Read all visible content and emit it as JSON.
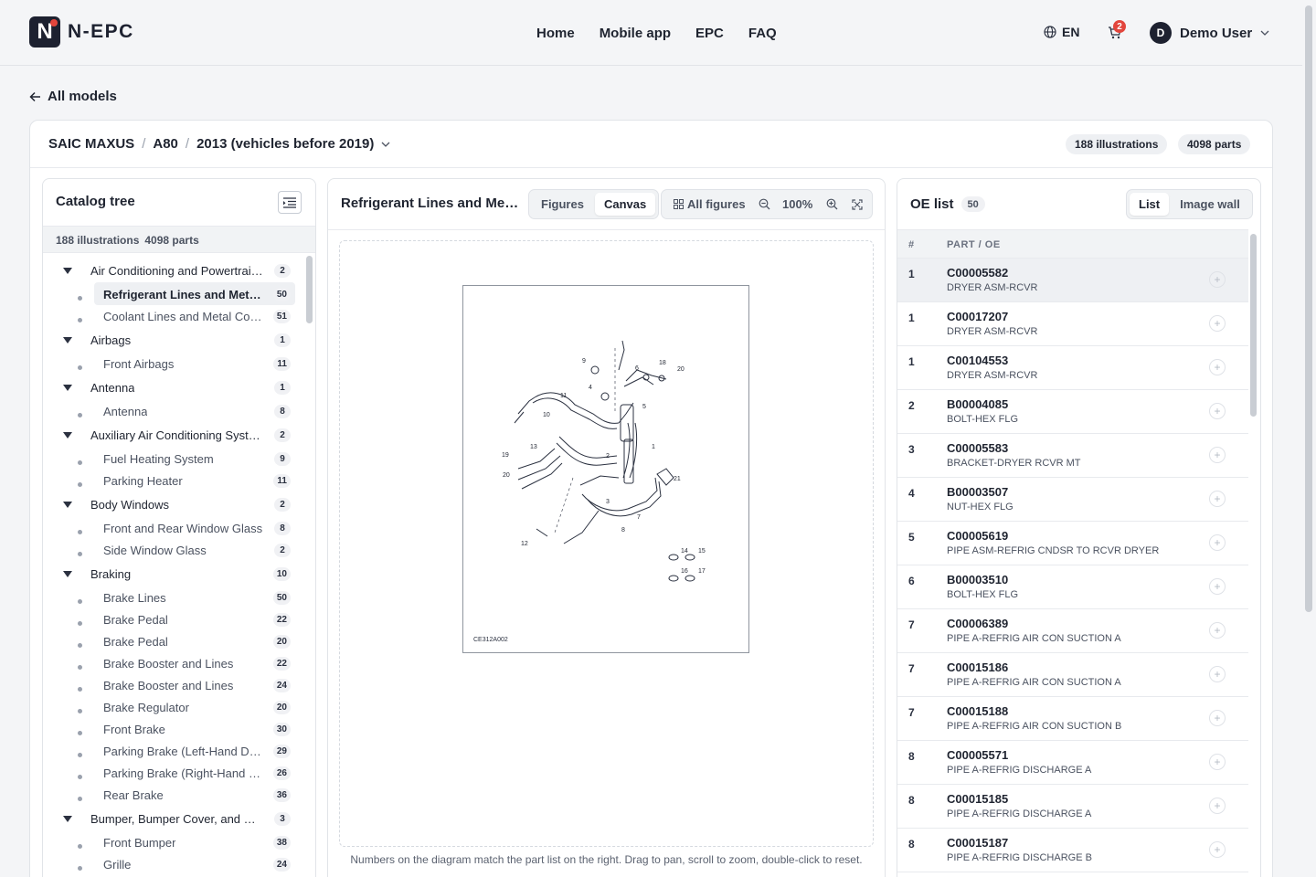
{
  "brand": {
    "name": "N-EPC",
    "logo_letter": "N"
  },
  "nav": {
    "items": [
      "Home",
      "Mobile app",
      "EPC",
      "FAQ"
    ]
  },
  "header": {
    "language": "EN",
    "cart_count": "2",
    "user_initial": "D",
    "user_name": "Demo User"
  },
  "back": {
    "label": "All models"
  },
  "breadcrumb": {
    "brand": "SAIC MAXUS",
    "model": "A80",
    "year": "2013 (vehicles before 2019)"
  },
  "stats": {
    "illustrations": "188 illustrations",
    "parts": "4098 parts"
  },
  "tree": {
    "title": "Catalog tree",
    "stats_illustrations": "188 illustrations",
    "stats_parts": "4098 parts",
    "items": [
      {
        "type": "cat",
        "label": "Air Conditioning and Powertrain Cooling",
        "count": "2"
      },
      {
        "type": "sub",
        "label": "Refrigerant Lines and Metal Components",
        "count": "50",
        "active": true
      },
      {
        "type": "sub",
        "label": "Coolant Lines and Metal Components",
        "count": "51"
      },
      {
        "type": "cat",
        "label": "Airbags",
        "count": "1"
      },
      {
        "type": "sub",
        "label": "Front Airbags",
        "count": "11"
      },
      {
        "type": "cat",
        "label": "Antenna",
        "count": "1"
      },
      {
        "type": "sub",
        "label": "Antenna",
        "count": "8"
      },
      {
        "type": "cat",
        "label": "Auxiliary Air Conditioning System",
        "count": "2"
      },
      {
        "type": "sub",
        "label": "Fuel Heating System",
        "count": "9"
      },
      {
        "type": "sub",
        "label": "Parking Heater",
        "count": "11"
      },
      {
        "type": "cat",
        "label": "Body Windows",
        "count": "2"
      },
      {
        "type": "sub",
        "label": "Front and Rear Window Glass",
        "count": "8"
      },
      {
        "type": "sub",
        "label": "Side Window Glass",
        "count": "2"
      },
      {
        "type": "cat",
        "label": "Braking",
        "count": "10"
      },
      {
        "type": "sub",
        "label": "Brake Lines",
        "count": "50"
      },
      {
        "type": "sub",
        "label": "Brake Pedal",
        "count": "22"
      },
      {
        "type": "sub",
        "label": "Brake Pedal",
        "count": "20"
      },
      {
        "type": "sub",
        "label": "Brake Booster and Lines",
        "count": "22"
      },
      {
        "type": "sub",
        "label": "Brake Booster and Lines",
        "count": "24"
      },
      {
        "type": "sub",
        "label": "Brake Regulator",
        "count": "20"
      },
      {
        "type": "sub",
        "label": "Front Brake",
        "count": "30"
      },
      {
        "type": "sub",
        "label": "Parking Brake (Left-Hand Drive)",
        "count": "29"
      },
      {
        "type": "sub",
        "label": "Parking Brake (Right-Hand Drive)",
        "count": "26"
      },
      {
        "type": "sub",
        "label": "Rear Brake",
        "count": "36"
      },
      {
        "type": "cat",
        "label": "Bumper, Bumper Cover, and Grille",
        "count": "3"
      },
      {
        "type": "sub",
        "label": "Front Bumper",
        "count": "38"
      },
      {
        "type": "sub",
        "label": "Grille",
        "count": "24"
      }
    ]
  },
  "canvas": {
    "title": "Refrigerant Lines and Metal Components",
    "view_figures": "Figures",
    "view_canvas": "Canvas",
    "all_figures": "All figures",
    "zoom": "100%",
    "figure_code": "CE312A002",
    "callouts": [
      "9",
      "6",
      "18",
      "20",
      "4",
      "11",
      "5",
      "10",
      "13",
      "19",
      "2",
      "1",
      "20",
      "21",
      "3",
      "7",
      "8",
      "12",
      "14",
      "15",
      "16",
      "17"
    ],
    "hint": "Numbers on the diagram match the part list on the right. Drag to pan, scroll to zoom, double-click to reset."
  },
  "oe": {
    "title": "OE list",
    "count": "50",
    "view_list": "List",
    "view_wall": "Image wall",
    "col_num": "#",
    "col_part": "PART / OE",
    "rows": [
      {
        "num": "1",
        "part": "C00005582",
        "desc": "DRYER ASM-RCVR"
      },
      {
        "num": "1",
        "part": "C00017207",
        "desc": "DRYER ASM-RCVR"
      },
      {
        "num": "1",
        "part": "C00104553",
        "desc": "DRYER ASM-RCVR"
      },
      {
        "num": "2",
        "part": "B00004085",
        "desc": "BOLT-HEX FLG"
      },
      {
        "num": "3",
        "part": "C00005583",
        "desc": "BRACKET-DRYER RCVR MT"
      },
      {
        "num": "4",
        "part": "B00003507",
        "desc": "NUT-HEX FLG"
      },
      {
        "num": "5",
        "part": "C00005619",
        "desc": "PIPE ASM-REFRIG CNDSR TO RCVR DRYER"
      },
      {
        "num": "6",
        "part": "B00003510",
        "desc": "BOLT-HEX FLG"
      },
      {
        "num": "7",
        "part": "C00006389",
        "desc": "PIPE A-REFRIG AIR CON SUCTION A"
      },
      {
        "num": "7",
        "part": "C00015186",
        "desc": "PIPE A-REFRIG AIR CON SUCTION A"
      },
      {
        "num": "7",
        "part": "C00015188",
        "desc": "PIPE A-REFRIG AIR CON SUCTION B"
      },
      {
        "num": "8",
        "part": "C00005571",
        "desc": "PIPE A-REFRIG DISCHARGE A"
      },
      {
        "num": "8",
        "part": "C00015185",
        "desc": "PIPE A-REFRIG DISCHARGE A"
      },
      {
        "num": "8",
        "part": "C00015187",
        "desc": "PIPE A-REFRIG DISCHARGE B"
      }
    ]
  },
  "colors": {
    "accent": "#1d2130",
    "badge": "#e2453c",
    "selected_row": "#eef0f3"
  }
}
